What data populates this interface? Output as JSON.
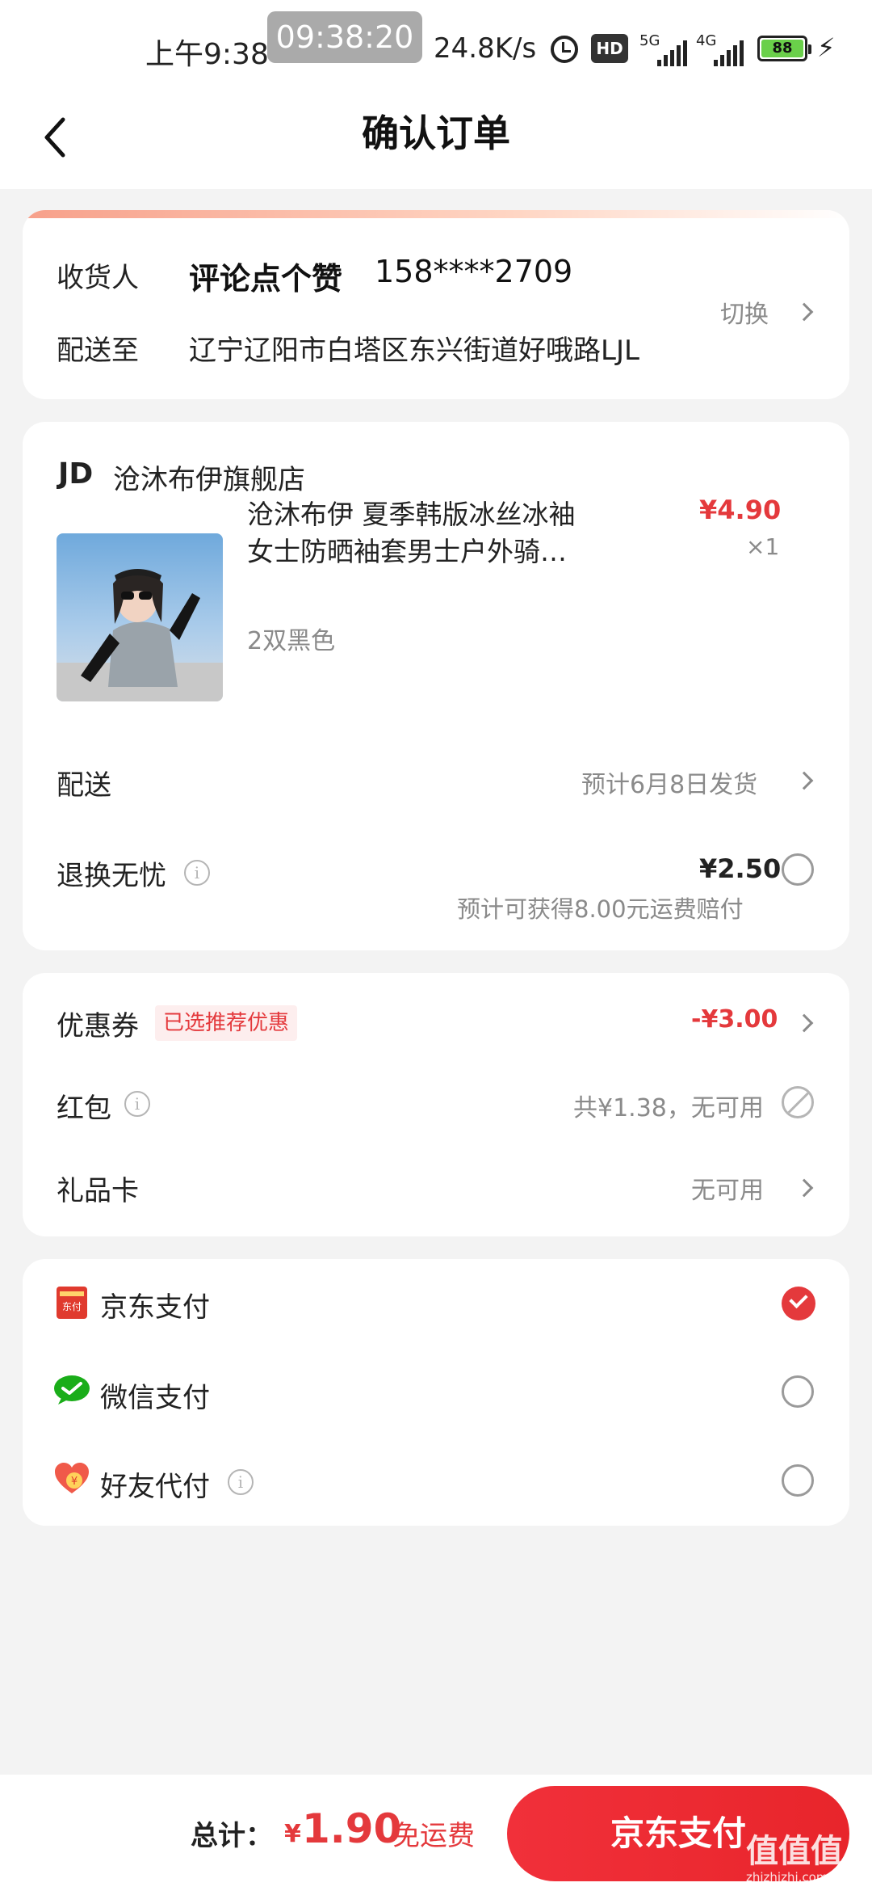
{
  "status_bar": {
    "time": "上午9:38",
    "recording_time": "09:38:20",
    "net_speed": "24.8K/s",
    "hd_label": "HD",
    "signal_1_label": "5G",
    "signal_2_label": "4G",
    "battery_level": "88"
  },
  "nav": {
    "title": "确认订单"
  },
  "address": {
    "receiver_label": "收货人",
    "receiver_name": "评论点个赞",
    "phone": "158****2709",
    "ship_to_label": "配送至",
    "address_text": "辽宁辽阳市白塔区东兴街道好哦路LJL",
    "switch_label": "切换"
  },
  "store": {
    "logo": "JD",
    "name": "沧沐布伊旗舰店"
  },
  "product": {
    "title_line1": "沧沐布伊 夏季韩版冰丝冰袖",
    "title_line2": "女士防晒袖套男士户外骑…",
    "price": "¥4.90",
    "quantity": "×1",
    "spec": "2双黑色"
  },
  "delivery": {
    "label": "配送",
    "value": "预计6月8日发货"
  },
  "return_insurance": {
    "label": "退换无忧",
    "price": "¥2.50",
    "note": "预计可获得8.00元运费赔付"
  },
  "discounts": {
    "coupon_label": "优惠券",
    "coupon_tag": "已选推荐优惠",
    "coupon_value": "-¥3.00",
    "redpacket_label": "红包",
    "redpacket_value": "共¥1.38，无可用",
    "giftcard_label": "礼品卡",
    "giftcard_value": "无可用"
  },
  "payment": {
    "jd_pay": "京东支付",
    "jd_pay_icon_text": "东付",
    "wechat_pay": "微信支付",
    "friend_pay": "好友代付",
    "selected": "京东支付"
  },
  "footer": {
    "total_label": "总计：",
    "currency": "¥",
    "total_amount": "1.90",
    "shipping_note": "免运费",
    "pay_button": "京东支付"
  },
  "watermark": {
    "logo": "值值值",
    "url": "zhizhizhi.com"
  },
  "colors": {
    "accent_red": "#e4393c",
    "page_bg": "#f3f3f3",
    "card_bg": "#ffffff",
    "muted_text": "#8a8a8a",
    "wechat_green": "#1aad19"
  }
}
